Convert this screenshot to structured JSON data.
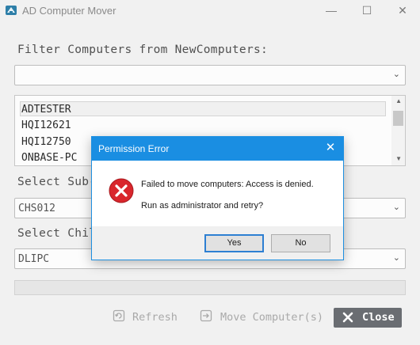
{
  "window": {
    "title": "AD Computer Mover",
    "minimize_glyph": "—",
    "maximize_glyph": "☐",
    "close_glyph": "✕"
  },
  "filter": {
    "label": "Filter Computers from NewComputers:",
    "value": ""
  },
  "computers": [
    "ADTESTER",
    "HQI12621",
    "HQI12750",
    "ONBASE-PC"
  ],
  "sub_ou": {
    "label": "Select Sub-",
    "value": "CHS012"
  },
  "child_ou": {
    "label": "Select Chil",
    "value": "DLIPC"
  },
  "buttons": {
    "refresh": "Refresh",
    "move": "Move Computer(s)",
    "close": "Close"
  },
  "dialog": {
    "title": "Permission Error",
    "close_glyph": "✕",
    "message_line1": "Failed to move computers: Access is denied.",
    "message_line2": "Run as administrator and retry?",
    "yes": "Yes",
    "no": "No"
  },
  "colors": {
    "dialog_titlebar": "#1a8ee2",
    "error_icon": "#d9262c",
    "close_button": "#6a6d72"
  },
  "icons": {
    "app": "app-icon",
    "error": "error-icon",
    "refresh": "refresh-icon",
    "move": "move-icon",
    "close": "close-x-icon"
  }
}
